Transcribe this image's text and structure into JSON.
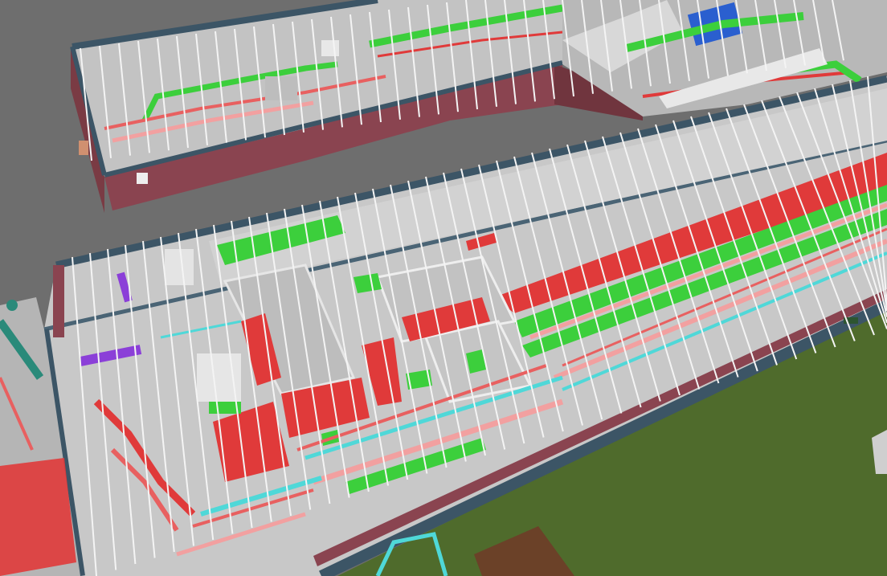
{
  "scene": {
    "kind": "3d-bim-model-view",
    "labels": [],
    "colors": {
      "background": "#6b6b6b",
      "ground_grass": "#4f6b2c",
      "roof_edge": "#3c5566",
      "wall_brick": "#8a4450",
      "floor_slab": "#c9c9c9",
      "duct_supply": "#e03a3a",
      "duct_return": "#3ccf3c",
      "pipe_cyan": "#4fd8d8",
      "pipe_pink": "#f2a0a0",
      "pipe_purple": "#8b3fd8",
      "truss_white": "#f4f4f4",
      "shed_brown": "#6b4128"
    }
  }
}
